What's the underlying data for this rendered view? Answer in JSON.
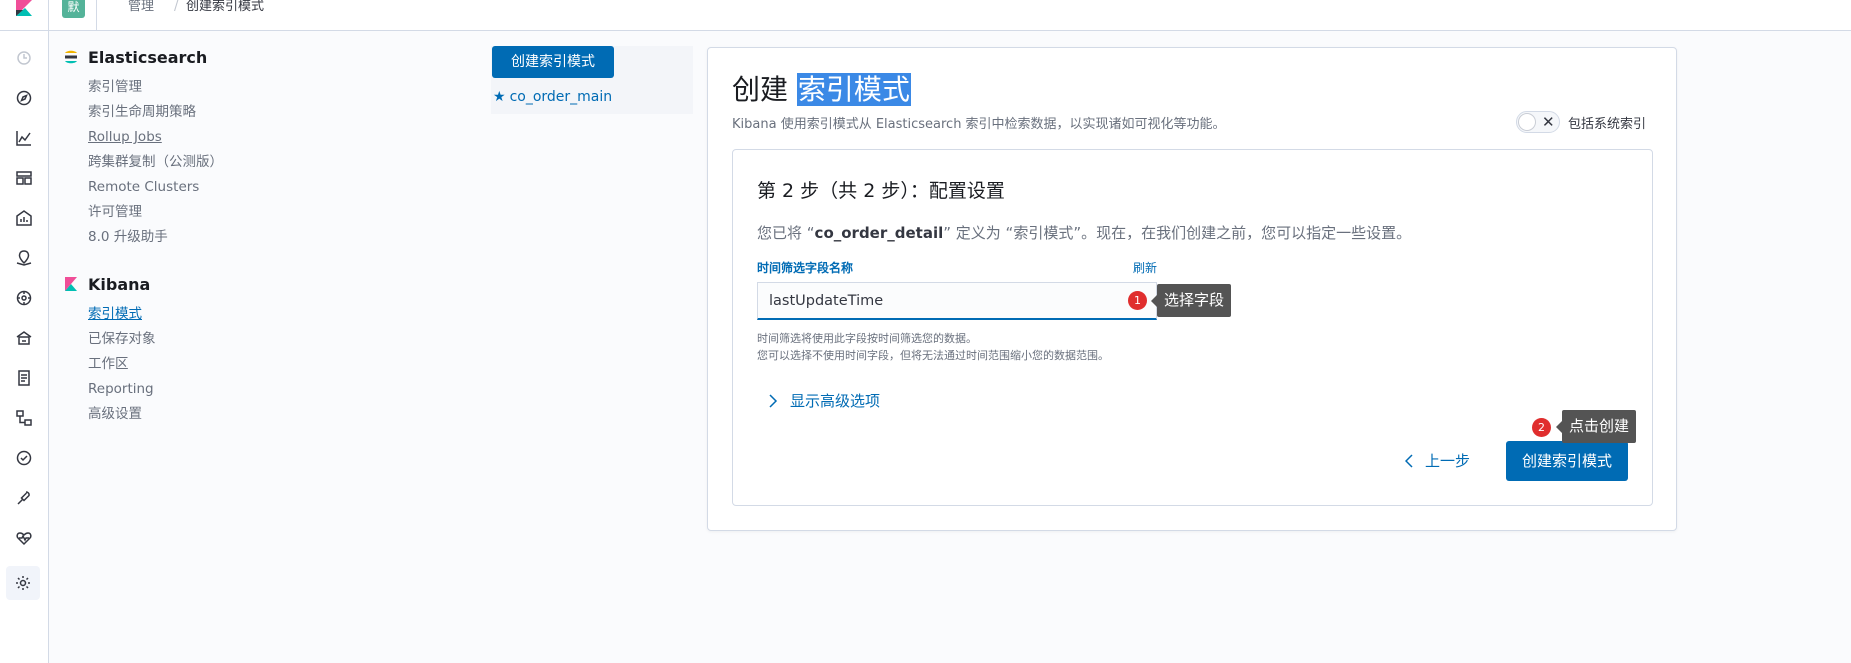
{
  "header": {
    "space_initial": "默",
    "breadcrumbs": [
      "管理",
      "创建索引模式"
    ],
    "breadcrumb_sep": "/"
  },
  "nav_icons": [
    "clock-icon",
    "compass-icon",
    "chart-icon",
    "dashboard-icon",
    "canvas-icon",
    "map-icon",
    "ml-icon",
    "infra-icon",
    "logs-icon",
    "apm-icon",
    "uptime-icon",
    "devtools-icon",
    "monitoring-icon",
    "management-gear-icon"
  ],
  "sidebar": {
    "elasticsearch": {
      "title": "Elasticsearch",
      "items": [
        "索引管理",
        "索引生命周期策略",
        "Rollup Jobs",
        "跨集群复制（公测版）",
        "Remote Clusters",
        "许可管理",
        "8.0 升级助手"
      ]
    },
    "kibana": {
      "title": "Kibana",
      "items": [
        "索引模式",
        "已保存对象",
        "工作区",
        "Reporting",
        "高级设置"
      ]
    }
  },
  "patterns": {
    "create_button": "创建索引模式",
    "items": [
      "co_order_main"
    ]
  },
  "main": {
    "title_prefix": "创建",
    "title_highlight": "索引模式",
    "description": "Kibana 使用索引模式从 Elasticsearch 索引中检索数据，以实现诸如可视化等功能。",
    "toggle_label": "包括系统索引",
    "toggle_on": false
  },
  "step": {
    "title": "第 2 步（共 2 步）：配置设置",
    "text_before": "您已将 “",
    "index_name": "co_order_detail",
    "text_after": "” 定义为 “索引模式”。现在，在我们创建之前，您可以指定一些设置。",
    "field_label": "时间筛选字段名称",
    "refresh": "刷新",
    "selected_field": "lastUpdateTime",
    "help_line1": "时间筛选将使用此字段按时间筛选您的数据。",
    "help_line2": "您可以选择不使用时间字段，但将无法通过时间范围缩小您的数据范围。",
    "advanced": "显示高级选项",
    "back": "上一步",
    "create": "创建索引模式"
  },
  "annotations": [
    {
      "number": "1",
      "text": "选择字段"
    },
    {
      "number": "2",
      "text": "点击创建"
    }
  ],
  "colors": {
    "primary": "#006bb4",
    "highlight": "#3b89e6",
    "badge": "#e02e2e",
    "callout": "#545454"
  }
}
